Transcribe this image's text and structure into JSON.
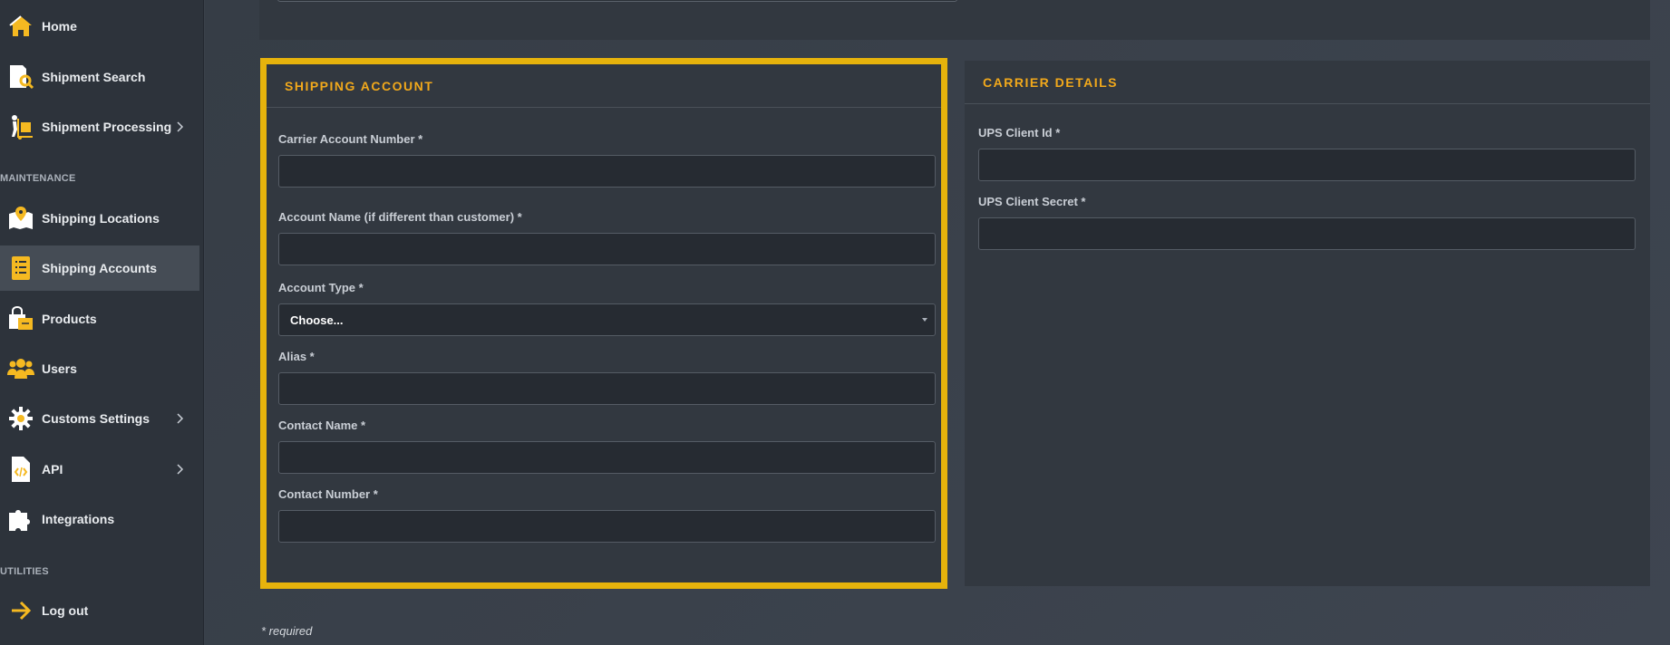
{
  "colors": {
    "accent": "#f2a91b",
    "highlight_border": "#e6b30c",
    "sidebar_bg": "#2d333b",
    "active_item_bg": "#454c55"
  },
  "sidebar": {
    "items": [
      {
        "label": "Home",
        "icon": "home-icon"
      },
      {
        "label": "Shipment Search",
        "icon": "document-search-icon"
      },
      {
        "label": "Shipment Processing",
        "icon": "dolly-icon",
        "has_submenu": true
      },
      {
        "label": "Shipping Locations",
        "icon": "map-pin-icon"
      },
      {
        "label": "Shipping Accounts",
        "icon": "list-icon",
        "active": true
      },
      {
        "label": "Products",
        "icon": "shopping-bag-icon"
      },
      {
        "label": "Users",
        "icon": "users-icon"
      },
      {
        "label": "Customs Settings",
        "icon": "gear-icon",
        "has_submenu": true
      },
      {
        "label": "API",
        "icon": "code-file-icon",
        "has_submenu": true
      },
      {
        "label": "Integrations",
        "icon": "puzzle-icon"
      },
      {
        "label": "Log out",
        "icon": "arrow-right-icon"
      }
    ],
    "sections": {
      "maintenance": "MAINTENANCE",
      "utilities": "UTILITIES"
    }
  },
  "shipping_account": {
    "title": "SHIPPING ACCOUNT",
    "fields": {
      "carrier_account_number": {
        "label": "Carrier Account Number *",
        "value": ""
      },
      "account_name": {
        "label": "Account Name (if different than customer) *",
        "value": ""
      },
      "account_type": {
        "label": "Account Type *",
        "selected": "Choose..."
      },
      "alias": {
        "label": "Alias *",
        "value": ""
      },
      "contact_name": {
        "label": "Contact Name *",
        "value": ""
      },
      "contact_number": {
        "label": "Contact Number *",
        "value": ""
      }
    }
  },
  "carrier_details": {
    "title": "CARRIER DETAILS",
    "fields": {
      "ups_client_id": {
        "label": "UPS Client Id *",
        "value": ""
      },
      "ups_client_secret": {
        "label": "UPS Client Secret *",
        "value": ""
      }
    }
  },
  "footer": {
    "required_note": "* required"
  }
}
